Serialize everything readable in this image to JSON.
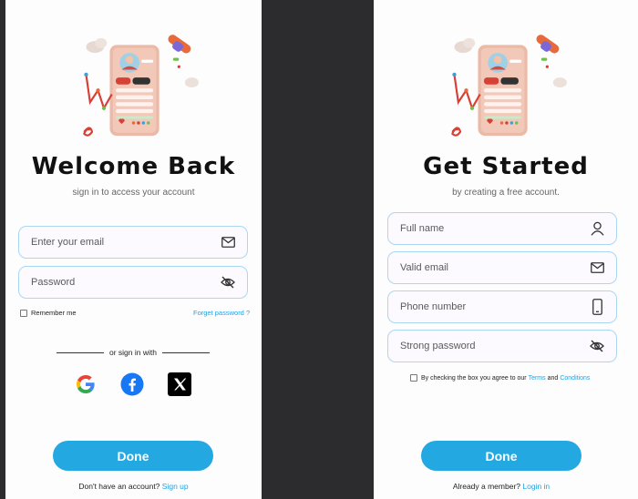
{
  "login": {
    "title": "Welcome Back",
    "subtitle": "sign in to access your account",
    "email_placeholder": "Enter your email",
    "password_placeholder": "Password",
    "remember_label": "Remember me",
    "forgot_label": "Forget password ?",
    "divider_label": "or sign in with",
    "social": [
      "google-icon",
      "facebook-icon",
      "x-icon"
    ],
    "done_label": "Done",
    "footer_text": "Don't have an account?",
    "footer_link": "Sign up"
  },
  "signup": {
    "title": "Get Started",
    "subtitle": "by creating a free account.",
    "name_placeholder": "Full name",
    "email_placeholder": "Valid email",
    "phone_placeholder": "Phone number",
    "password_placeholder": "Strong password",
    "agree_text": "By checking the box you agree to our",
    "terms_label": "Terms",
    "and_label": "and",
    "conditions_label": "Conditions",
    "done_label": "Done",
    "footer_text": "Already a member?",
    "footer_link": "Login in"
  },
  "colors": {
    "accent": "#23a8e2",
    "field_border": "#a9d8f0",
    "link": "#1ea3e3"
  }
}
